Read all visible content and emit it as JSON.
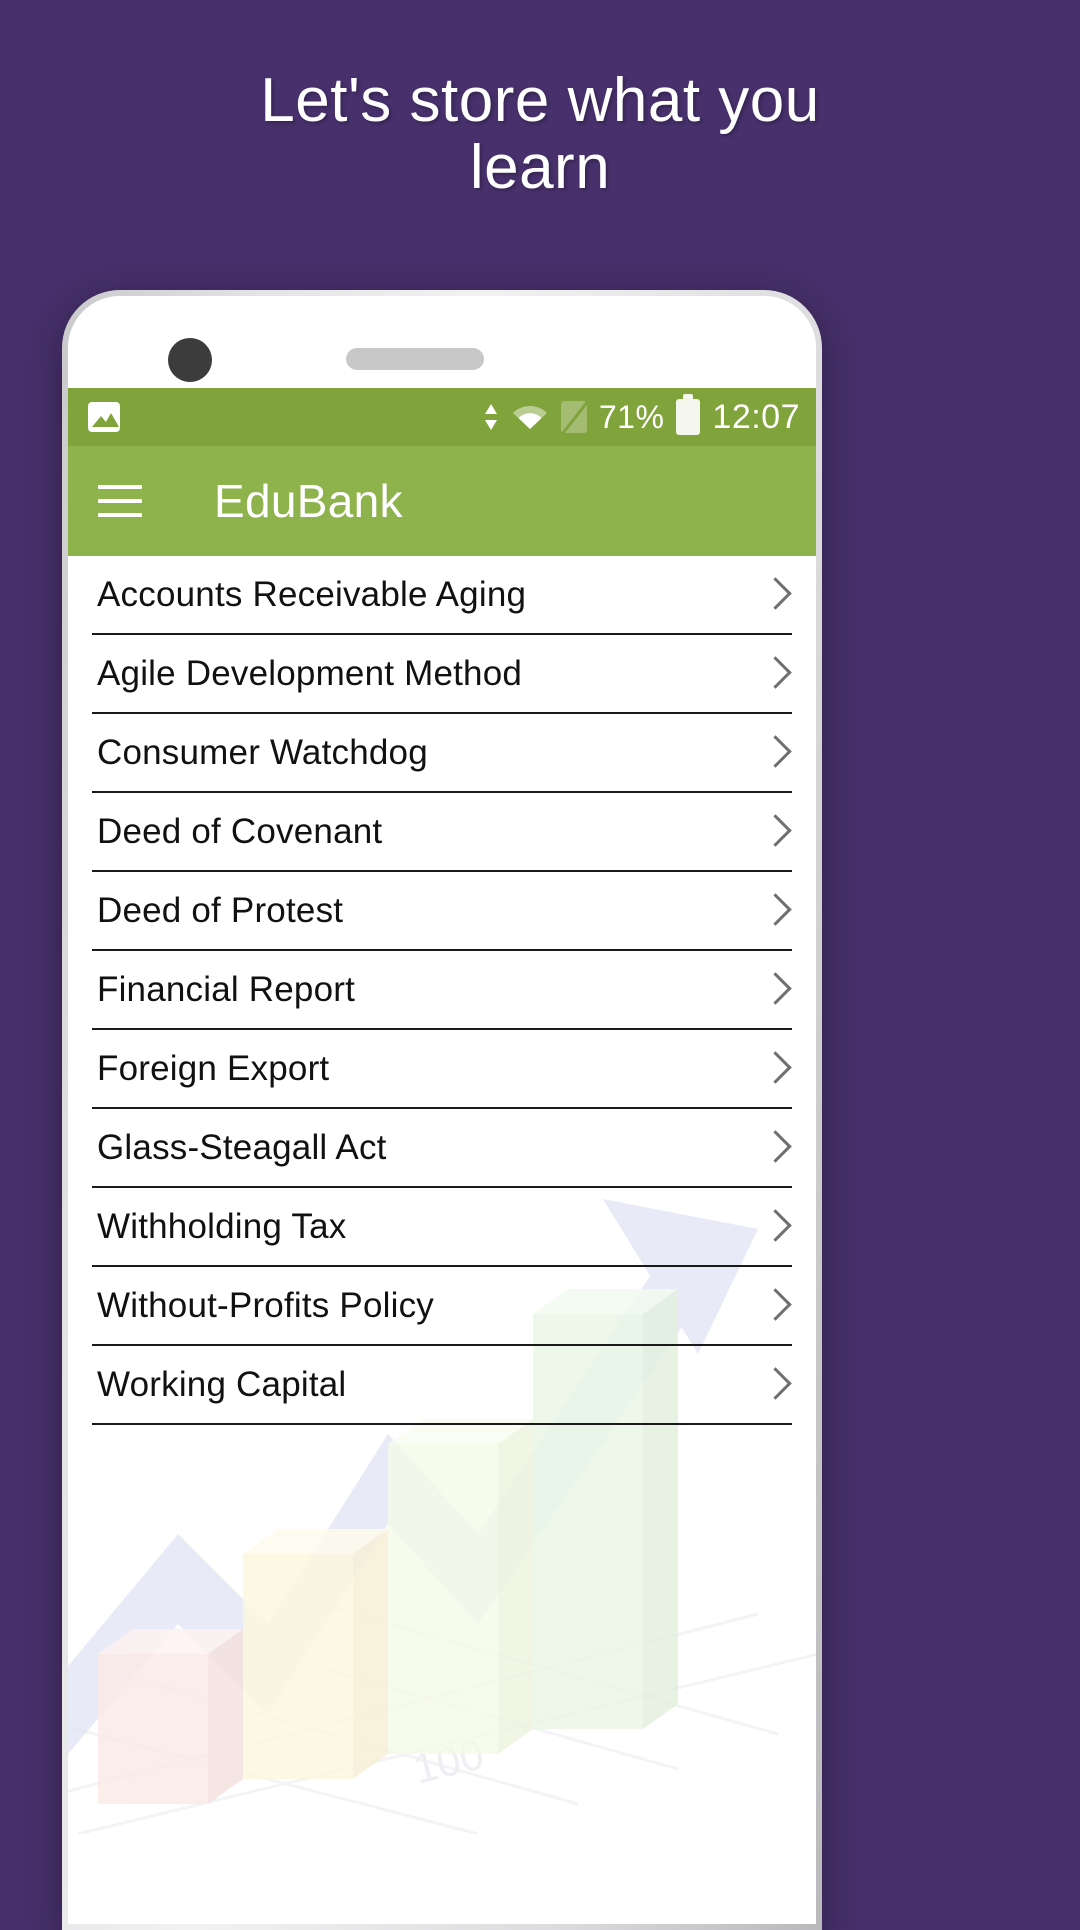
{
  "promo": {
    "headline": "Let's store what you\nlearn",
    "background_color": "#47306b"
  },
  "statusbar": {
    "gallery_icon": "gallery-icon",
    "sync_icon": "sync-arrows-icon",
    "wifi_icon": "wifi-icon",
    "sim_icon": "no-sim-icon",
    "battery_percent": "71%",
    "battery_icon": "battery-icon",
    "time": "12:07",
    "background_color": "#80a33c"
  },
  "appbar": {
    "menu_icon": "hamburger-menu-icon",
    "title": "EduBank",
    "background_color": "#8fb34c"
  },
  "list": {
    "chevron_icon": "chevron-right-icon",
    "items": [
      {
        "label": "Accounts Receivable Aging"
      },
      {
        "label": "Agile Development Method"
      },
      {
        "label": "Consumer Watchdog"
      },
      {
        "label": "Deed of Covenant"
      },
      {
        "label": "Deed of Protest"
      },
      {
        "label": "Financial Report"
      },
      {
        "label": "Foreign Export"
      },
      {
        "label": "Glass-Steagall Act"
      },
      {
        "label": "Withholding Tax"
      },
      {
        "label": "Without-Profits Policy"
      },
      {
        "label": "Working Capital"
      }
    ]
  },
  "watermark": {
    "description": "faint 3d bar chart with rising arrow",
    "axis_label": "100",
    "bar_colors": [
      "#f2c9c4",
      "#f7edb8",
      "#e0f0c6",
      "#c8ecc4"
    ],
    "arrow_color": "#c3c6ec"
  }
}
